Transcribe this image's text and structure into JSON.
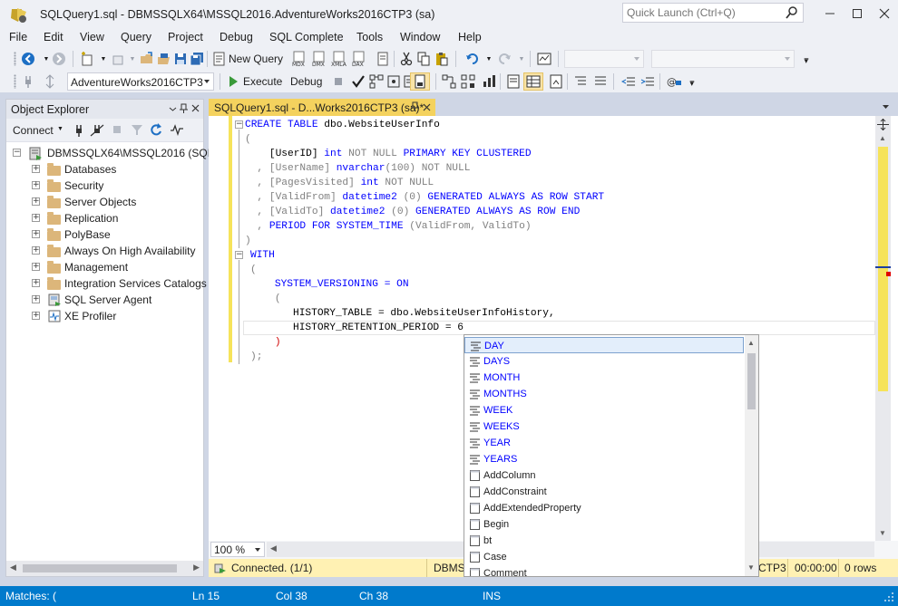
{
  "window": {
    "title": "SQLQuery1.sql - DBMSSQLX64\\MSSQL2016.AdventureWorks2016CTP3 (sa)",
    "quick_launch_placeholder": "Quick Launch (Ctrl+Q)"
  },
  "menu": [
    "File",
    "Edit",
    "View",
    "Query",
    "Project",
    "Debug",
    "SQL Complete",
    "Tools",
    "Window",
    "Help"
  ],
  "toolbar": {
    "new_query": "New Query",
    "execute": "Execute",
    "debug": "Debug",
    "database": "AdventureWorks2016CTP3"
  },
  "object_explorer": {
    "title": "Object Explorer",
    "connect": "Connect",
    "root": "DBMSSQLX64\\MSSQL2016 (SQL",
    "nodes": [
      "Databases",
      "Security",
      "Server Objects",
      "Replication",
      "PolyBase",
      "Always On High Availability",
      "Management",
      "Integration Services Catalogs",
      "SQL Server Agent",
      "XE Profiler"
    ]
  },
  "editor": {
    "tab_title": "SQLQuery1.sql - D...Works2016CTP3 (sa)*",
    "zoom": "100 %",
    "code": {
      "l1a": "CREATE TABLE",
      "l1b": " dbo.WebsiteUserInfo",
      "l2": "(",
      "l3a": "    [UserID] ",
      "l3b": "int",
      "l3c": " NOT NULL",
      "l3d": " PRIMARY KEY CLUSTERED",
      "l4a": "  , [UserName] ",
      "l4b": "nvarchar",
      "l4c": "(100)",
      "l4d": " NOT NULL",
      "l5a": "  , [PagesVisited] ",
      "l5b": "int",
      "l5c": " NOT NULL",
      "l6a": "  , [ValidFrom] ",
      "l6b": "datetime2",
      "l6c": " (0)",
      "l6d": " GENERATED ALWAYS AS ROW START",
      "l7a": "  , [ValidTo] ",
      "l7b": "datetime2",
      "l7c": " (0)",
      "l7d": " GENERATED ALWAYS AS ROW END",
      "l8a": "  , ",
      "l8b": "PERIOD FOR SYSTEM_TIME",
      "l8c": " (ValidFrom, ValidTo)",
      "l9": ")",
      "l10": "WITH",
      "l11": "(",
      "l12a": "    SYSTEM_VERSIONING = ON",
      "l13": "    (",
      "l14a": "       HISTORY_TABLE = dbo.WebsiteUserInfoHistory,",
      "l15a": "       HISTORY_RETENTION_PERIOD = 6",
      "l16": "    )",
      "l17": ");"
    }
  },
  "autocomplete": {
    "keywords": [
      "DAY",
      "DAYS",
      "MONTH",
      "MONTHS",
      "WEEK",
      "WEEKS",
      "YEAR",
      "YEARS"
    ],
    "functions": [
      "AddColumn",
      "AddConstraint",
      "AddExtendedProperty",
      "Begin",
      "bt",
      "Case",
      "Comment"
    ]
  },
  "connection": {
    "status": "Connected. (1/1)",
    "server": "DBMS",
    "db_suffix": "CTP3",
    "time": "00:00:00",
    "rows": "0 rows"
  },
  "statusbar": {
    "matches": "Matches: (",
    "ln": "Ln 15",
    "col": "Col 38",
    "ch": "Ch 38",
    "mode": "INS"
  },
  "colors": {
    "accent": "#007acc",
    "keyword": "#0000ff",
    "tab": "#f5f5c4",
    "connection_bar": "#fff1b3"
  }
}
